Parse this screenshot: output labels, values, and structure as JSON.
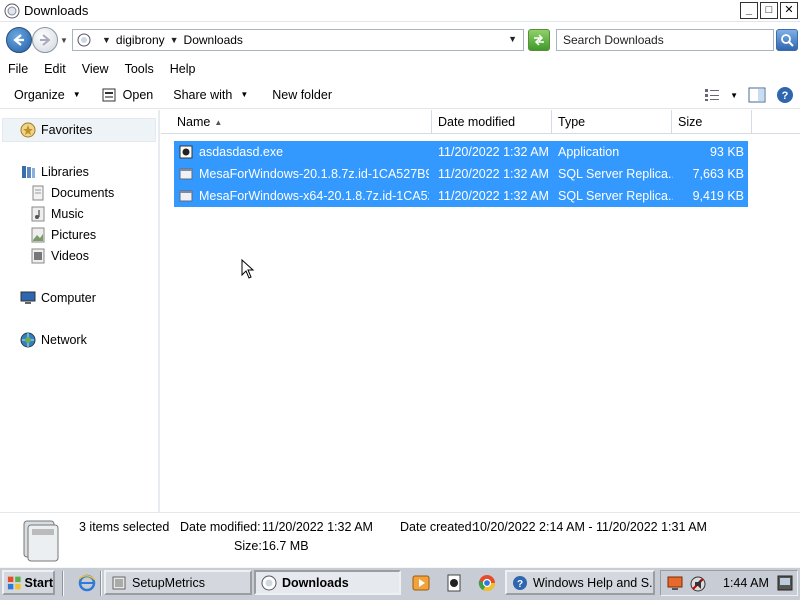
{
  "window": {
    "title": "Downloads",
    "controls": {
      "minimize": "_",
      "maximize": "□",
      "close": "✕"
    }
  },
  "address_bar": {
    "breadcrumbs": [
      "digibrony",
      "Downloads"
    ],
    "search_placeholder": "Search Downloads"
  },
  "menu": [
    "File",
    "Edit",
    "View",
    "Tools",
    "Help"
  ],
  "toolbar": {
    "organize": "Organize",
    "open": "Open",
    "share_with": "Share with",
    "new_folder": "New folder"
  },
  "nav_pane": {
    "favorites": "Favorites",
    "libraries": "Libraries",
    "library_items": [
      "Documents",
      "Music",
      "Pictures",
      "Videos"
    ],
    "computer": "Computer",
    "network": "Network"
  },
  "columns": {
    "name": "Name",
    "date_modified": "Date modified",
    "type": "Type",
    "size": "Size",
    "sort_indicator": "▲"
  },
  "files": [
    {
      "name": "asdasdasd.exe",
      "date": "11/20/2022 1:32 AM",
      "type": "Application",
      "size": "93 KB",
      "icon": "application-icon"
    },
    {
      "name": "MesaForWindows-20.1.8.7z.id-1CA527B9....",
      "date": "11/20/2022 1:32 AM",
      "type": "SQL Server Replica...",
      "size": "7,663 KB",
      "icon": "file-icon"
    },
    {
      "name": "MesaForWindows-x64-20.1.8.7z.id-1CA52....",
      "date": "11/20/2022 1:32 AM",
      "type": "SQL Server Replica...",
      "size": "9,419 KB",
      "icon": "file-icon"
    }
  ],
  "details": {
    "selected_count": "3 items selected",
    "date_modified_label": "Date modified:",
    "date_modified_value": "11/20/2022 1:32 AM",
    "date_created_label": "Date created:",
    "date_created_value": "10/20/2022 2:14 AM - 11/20/2022 1:31 AM",
    "size_label": "Size:",
    "size_value": "16.7 MB"
  },
  "taskbar": {
    "start": "Start",
    "tasks": [
      {
        "label": "SetupMetrics",
        "active": false
      },
      {
        "label": "Downloads",
        "active": true
      },
      {
        "label": "Windows Help and S...",
        "active": false
      }
    ],
    "clock": "1:44 AM"
  },
  "colors": {
    "selection": "#3399ff",
    "taskbar": "#c8ccd4",
    "accent_blue": "#1f5fa8"
  }
}
